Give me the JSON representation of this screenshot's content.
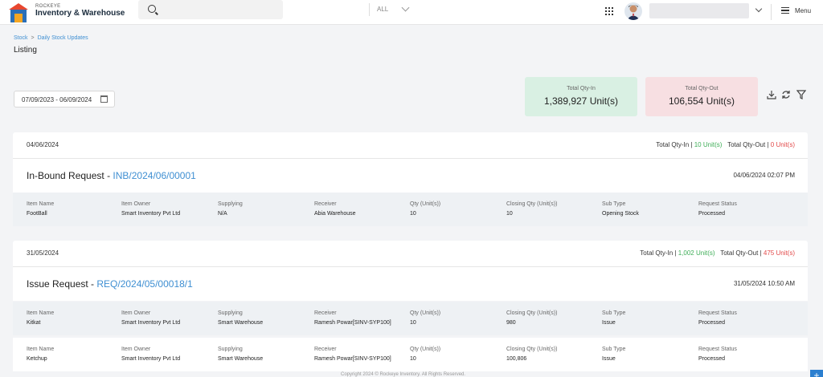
{
  "header": {
    "brand_small": "ROCKEYE",
    "brand_name": "Inventory & Warehouse",
    "search_placeholder": "",
    "search_scope": "ALL",
    "menu_label": "Menu"
  },
  "breadcrumb": [
    "Stock",
    "Daily Stock Updates"
  ],
  "page_title": "Listing",
  "filters": {
    "date_range": "07/09/2023 - 06/09/2024"
  },
  "summary": {
    "in_label": "Total Qty-In",
    "in_value": "1,389,927 Unit(s)",
    "out_label": "Total Qty-Out",
    "out_value": "106,554 Unit(s)"
  },
  "colors": {
    "accent": "#3f8fd2",
    "green": "#3fae58",
    "red": "#e24a4a",
    "in_card": "#d9f0e3",
    "out_card": "#f7dfe2"
  },
  "labels": {
    "item_name": "Item Name",
    "item_owner": "Item Owner",
    "supplying": "Supplying",
    "receiver": "Receiver",
    "qty": "Qty (Unit(s))",
    "closing_qty": "Closing Qty (Unit(s))",
    "sub_type": "Sub Type",
    "request_status": "Request Status",
    "total_in": "Total Qty-In",
    "total_out": "Total Qty-Out",
    "pipe": "|"
  },
  "groups": [
    {
      "date": "04/06/2024",
      "total_in": "10 Unit(s)",
      "total_out": "0 Unit(s)",
      "request": {
        "type": "In-Bound Request - ",
        "id": "INB/2024/06/00001",
        "datetime": "04/06/2024 02:07 PM"
      },
      "items": [
        {
          "item_name": "FootBall",
          "item_owner": "Smart Inventory Pvt Ltd",
          "supplying": "N/A",
          "receiver": "Abia Warehouse",
          "qty": "10",
          "closing_qty": "10",
          "sub_type": "Opening Stock",
          "status": "Processed"
        }
      ]
    },
    {
      "date": "31/05/2024",
      "total_in": "1,002 Unit(s)",
      "total_out": "475 Unit(s)",
      "request": {
        "type": "Issue Request - ",
        "id": "REQ/2024/05/00018/1",
        "datetime": "31/05/2024 10:50 AM"
      },
      "items": [
        {
          "item_name": "Kitkat",
          "item_owner": "Smart Inventory Pvt Ltd",
          "supplying": "Smart Warehouse",
          "receiver": "Ramesh Powar[SINV-SYP100]",
          "qty": "10",
          "closing_qty": "980",
          "sub_type": "Issue",
          "status": "Processed"
        },
        {
          "item_name": "Ketchup",
          "item_owner": "Smart Inventory Pvt Ltd",
          "supplying": "Smart Warehouse",
          "receiver": "Ramesh Powar[SINV-SYP100]",
          "qty": "10",
          "closing_qty": "100,806",
          "sub_type": "Issue",
          "status": "Processed"
        }
      ]
    }
  ],
  "footer": "Copyright 2024 © Rockeye Inventory. All Rights Reserved.",
  "fab_label": "+"
}
